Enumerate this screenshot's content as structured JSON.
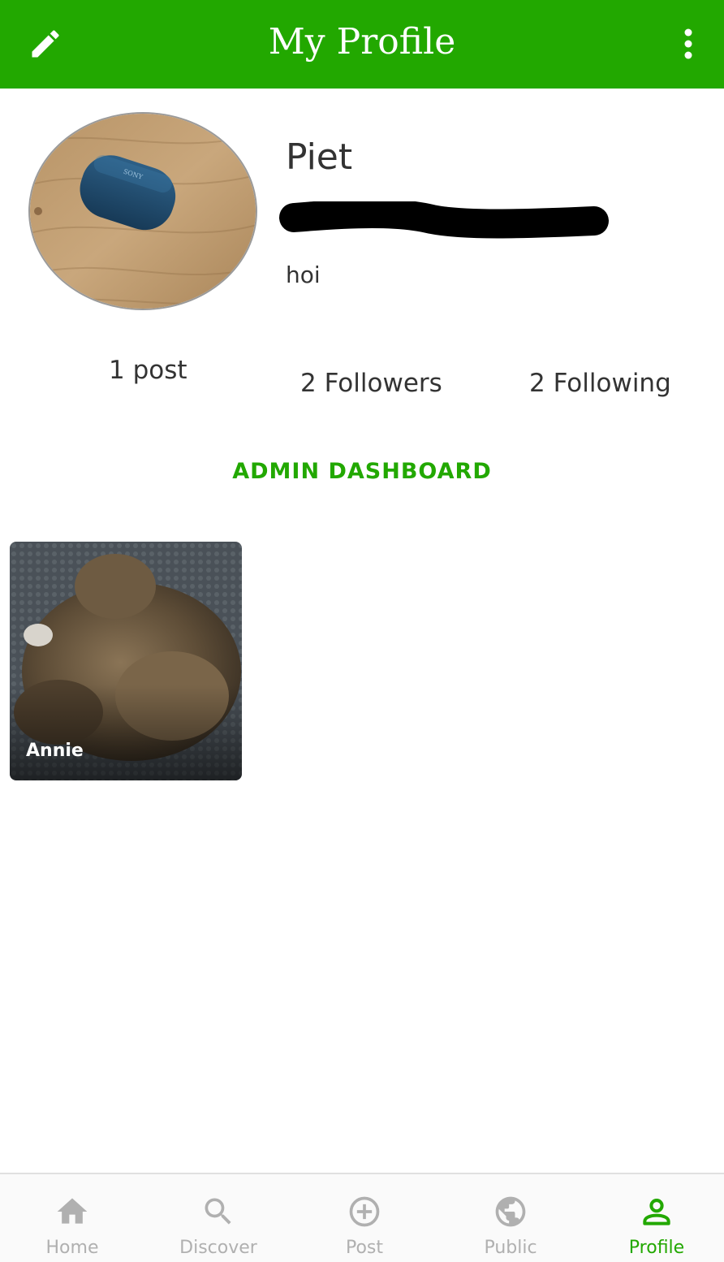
{
  "appbar": {
    "title": "My Profile",
    "edit_icon": "pencil-icon",
    "more_icon": "more-vertical-icon",
    "color": "#22a800"
  },
  "profile": {
    "name": "Piet",
    "bio": "hoi",
    "avatar": "profile-photo-earbud-case"
  },
  "stats": {
    "posts": "1 post",
    "followers": "2 Followers",
    "following": "2 Following"
  },
  "admin_link": "ADMIN DASHBOARD",
  "posts": [
    {
      "caption": "Annie",
      "image": "cat-photo"
    }
  ],
  "bottom_nav": {
    "items": [
      {
        "label": "Home",
        "icon": "home-icon"
      },
      {
        "label": "Discover",
        "icon": "search-icon"
      },
      {
        "label": "Post",
        "icon": "add-circle-icon"
      },
      {
        "label": "Public",
        "icon": "globe-icon"
      },
      {
        "label": "Profile",
        "icon": "person-icon"
      }
    ],
    "active": "Profile",
    "active_color": "#22a800",
    "inactive_color": "#b0b0b0"
  }
}
